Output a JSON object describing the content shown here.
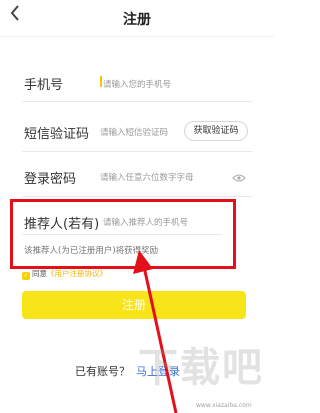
{
  "header": {
    "title": "注册",
    "back_icon": "chevron-left-icon"
  },
  "form": {
    "phone": {
      "label": "手机号",
      "placeholder": "请输入您的手机号"
    },
    "sms": {
      "label": "短信验证码",
      "placeholder": "请输入短信验证码",
      "button": "获取验证码"
    },
    "password": {
      "label": "登录密码",
      "placeholder": "请输入任意六位数字字母",
      "icon": "eye-icon"
    },
    "referrer": {
      "label": "推荐人(若有)",
      "placeholder": "请输入推荐人的手机号",
      "hint": "该推荐人(为已注册用户)将获得奖励"
    },
    "agreement": {
      "prefix": "同意",
      "link": "《用户注册协议》",
      "checked": true
    },
    "submit": {
      "label": "注册"
    }
  },
  "footer": {
    "text": "已有账号？",
    "link": "马上登录"
  },
  "watermark": {
    "text": "下载吧",
    "url": "www.xiazaiba.com"
  },
  "colors": {
    "accent": "#f7e419",
    "highlight": "#e3101a",
    "link": "#3a72d8"
  }
}
